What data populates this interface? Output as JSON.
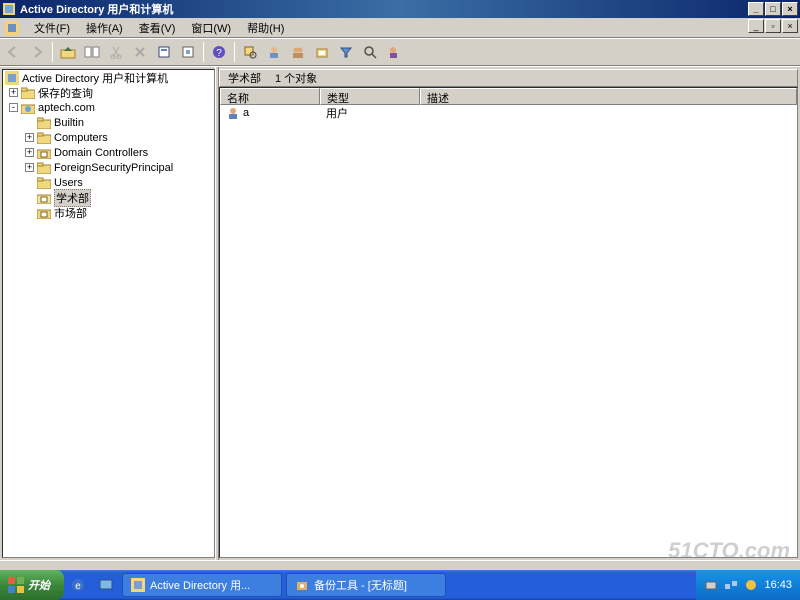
{
  "title": "Active Directory 用户和计算机",
  "menu": {
    "items": [
      "文件(F)",
      "操作(A)",
      "查看(V)",
      "窗口(W)",
      "帮助(H)"
    ]
  },
  "tree": {
    "root": "Active Directory 用户和计算机",
    "nodes": [
      {
        "label": "保存的查询",
        "expander": "+"
      },
      {
        "label": "aptech.com",
        "expander": "-"
      }
    ],
    "children": [
      {
        "label": "Builtin",
        "expander": ""
      },
      {
        "label": "Computers",
        "expander": "+"
      },
      {
        "label": "Domain Controllers",
        "expander": "+"
      },
      {
        "label": "ForeignSecurityPrincipal",
        "expander": "+"
      },
      {
        "label": "Users",
        "expander": ""
      },
      {
        "label": "学术部",
        "expander": "",
        "selected": true
      },
      {
        "label": "市场部",
        "expander": ""
      }
    ]
  },
  "content_header": {
    "name": "学术部",
    "count": "1 个对象"
  },
  "columns": [
    "名称",
    "类型",
    "描述"
  ],
  "rows": [
    {
      "name": "a",
      "type": "用户",
      "desc": ""
    }
  ],
  "taskbar": {
    "start": "开始",
    "items": [
      {
        "label": "Active Directory 用..."
      },
      {
        "label": "备份工具 - [无标题]"
      }
    ],
    "clock": "16:43"
  },
  "watermark": "51CTO.com"
}
